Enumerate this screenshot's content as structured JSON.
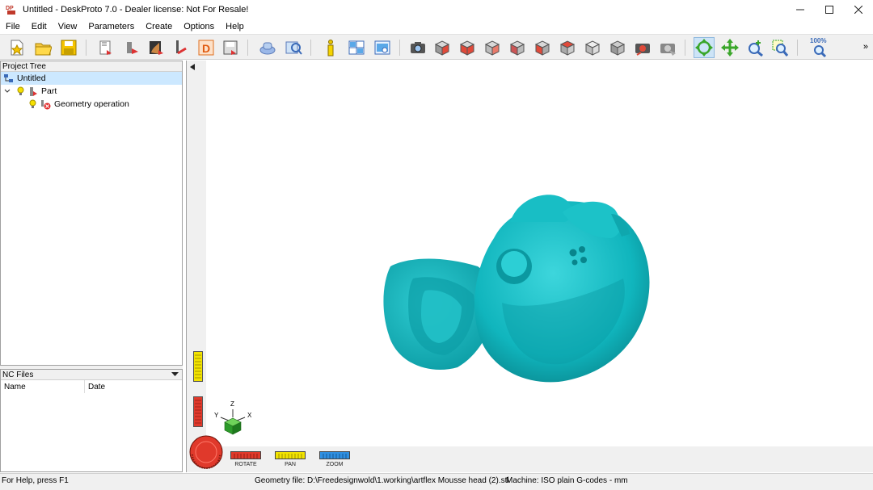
{
  "window": {
    "title": "Untitled - DeskProto 7.0 - Dealer license: Not For Resale!",
    "icon": "deskproto-logo-icon"
  },
  "menu": [
    "File",
    "Edit",
    "View",
    "Parameters",
    "Create",
    "Options",
    "Help"
  ],
  "toolbar": {
    "zoom_percent_label": "100%",
    "overflow": "»"
  },
  "project_tree": {
    "header": "Project Tree",
    "items": [
      {
        "label": "Untitled",
        "icon": "project-icon"
      },
      {
        "label": "Part",
        "icon": "part-icon"
      },
      {
        "label": "Geometry operation",
        "icon": "geometry-operation-icon"
      }
    ]
  },
  "nc_files": {
    "header": "NC Files",
    "columns": [
      "Name",
      "Date"
    ]
  },
  "viewport": {
    "model_color": "#10b5bd",
    "axes": {
      "z": "Z",
      "y": "Y",
      "x": "X"
    },
    "controls": {
      "rotate": "ROTATE",
      "pan": "PAN",
      "zoom": "ZOOM"
    }
  },
  "status": {
    "help": "For Help, press F1",
    "geometry_file": "Geometry file: D:\\Freedesignwold\\1.working\\artflex Mousse head (2).stl",
    "machine": "Machine: ISO plain G-codes - mm"
  },
  "colors": {
    "accent_active": "#cde4f7",
    "rotate": "#e0392b",
    "pan": "#f2e300",
    "zoom": "#2f8fe0"
  }
}
